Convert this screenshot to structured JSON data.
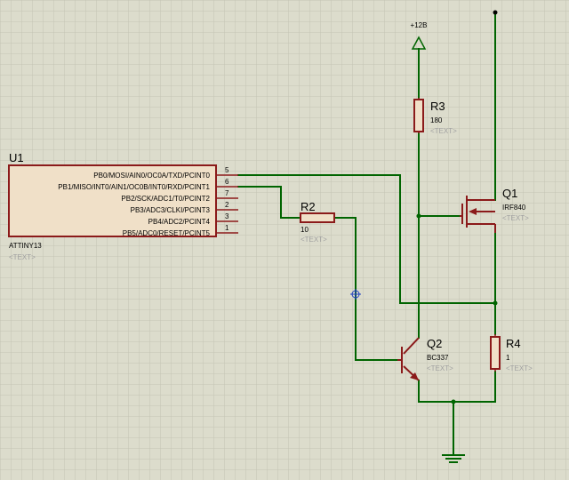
{
  "u1": {
    "ref": "U1",
    "part": "ATTINY13",
    "placeholder": "<TEXT>",
    "pins": [
      {
        "name": "PB0/MOSI/AIN0/OC0A/TXD/PCINT0",
        "num": "5"
      },
      {
        "name": "PB1/MISO/INT0/AIN1/OC0B/INT0/RXD/PCINT1",
        "num": "6"
      },
      {
        "name": "PB2/SCK/ADC1/T0/PCINT2",
        "num": "7"
      },
      {
        "name": "PB3/ADC3/CLKI/PCINT3",
        "num": "2"
      },
      {
        "name": "PB4/ADC2/PCINT4",
        "num": "3"
      },
      {
        "name": "PB5/ADC0/RESET/PCINT5",
        "num": "1"
      }
    ]
  },
  "r2": {
    "ref": "R2",
    "value": "10",
    "placeholder": "<TEXT>"
  },
  "r3": {
    "ref": "R3",
    "value": "180",
    "placeholder": "<TEXT>"
  },
  "r4": {
    "ref": "R4",
    "value": "1",
    "placeholder": "<TEXT>"
  },
  "q1": {
    "ref": "Q1",
    "part": "IRF840",
    "placeholder": "<TEXT>"
  },
  "q2": {
    "ref": "Q2",
    "part": "BC337",
    "placeholder": "<TEXT>"
  },
  "power": {
    "label": "+12B"
  },
  "colors": {
    "wire": "#006400",
    "component": "#8b1a1a",
    "body_fill": "#f0e0c8",
    "grid": "#c4c4b4",
    "background": "#dcdccc"
  }
}
